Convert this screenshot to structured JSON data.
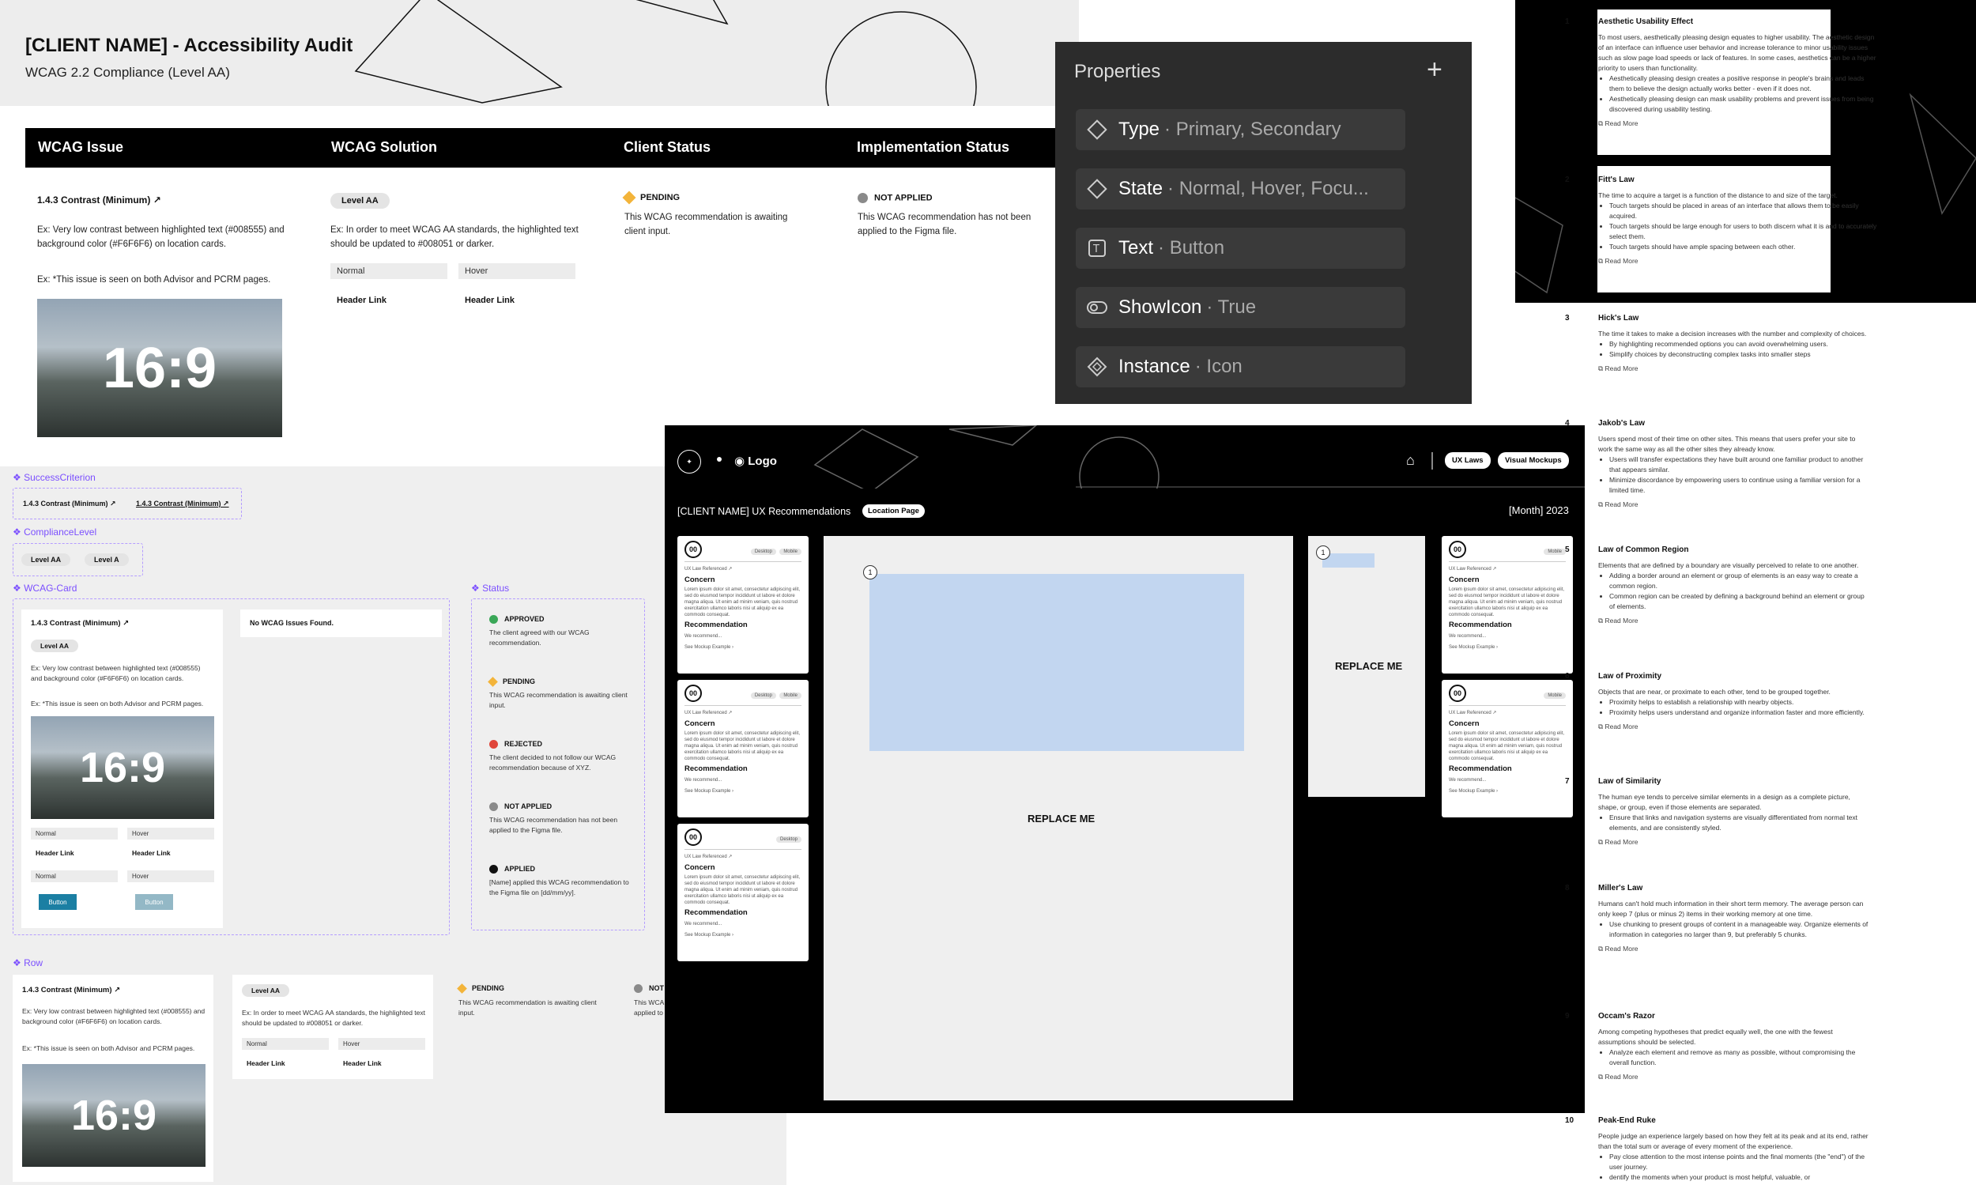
{
  "header": {
    "title": "[CLIENT NAME] - Accessibility Audit",
    "subtitle": "WCAG 2.2 Compliance (Level AA)"
  },
  "table": {
    "columns": [
      "WCAG Issue",
      "WCAG Solution",
      "Client Status",
      "Implementation Status"
    ],
    "issue": {
      "title": "1.4.3 Contrast (Minimum)",
      "desc": "Ex: Very low contrast between highlighted text (#008555) and background color (#F6F6F6) on location cards.",
      "note": "Ex: *This issue is seen on both Advisor and PCRM pages.",
      "image_label": "16:9"
    },
    "solution": {
      "level": "Level AA",
      "desc": "Ex: In order to meet WCAG AA standards, the highlighted text should be updated to #008051 or darker.",
      "field_normal": "Normal",
      "field_hover": "Hover",
      "link_normal": "Header Link",
      "link_hover": "Header Link"
    },
    "client_status": {
      "label": "PENDING",
      "desc": "This WCAG recommendation is awaiting client input."
    },
    "impl_status": {
      "label": "NOT APPLIED",
      "desc": "This WCAG recommendation has not been applied to the Figma file."
    }
  },
  "components": {
    "success_criterion": {
      "label": "SuccessCriterion",
      "items": [
        "1.4.3 Contrast (Minimum)",
        "1.4.3 Contrast (Minimum)"
      ]
    },
    "compliance_level": {
      "label": "ComplianceLevel",
      "items": [
        "Level AA",
        "Level A"
      ]
    },
    "wcag_card": {
      "label": "WCAG-Card",
      "title": "1.4.3 Contrast (Minimum)",
      "level": "Level AA",
      "desc": "Ex: Very low contrast between highlighted text (#008555) and background color (#F6F6F6) on location cards.",
      "note": "Ex: *This issue is seen on both Advisor and PCRM pages.",
      "image_label": "16:9",
      "field_normal": "Normal",
      "field_hover": "Hover",
      "link_normal": "Header Link",
      "link_hover": "Header Link",
      "field_normal2": "Normal",
      "field_hover2": "Hover",
      "button_normal": "Button",
      "button_hover": "Button",
      "empty": "No WCAG Issues Found."
    },
    "status": {
      "label": "Status",
      "items": [
        {
          "label": "APPROVED",
          "desc": "The client agreed with our WCAG recommendation.",
          "color": "#3aa757"
        },
        {
          "label": "PENDING",
          "desc": "This WCAG recommendation is awaiting client input.",
          "color": "#f3b43a"
        },
        {
          "label": "REJECTED",
          "desc": "The client decided to not follow our WCAG recommendation because of XYZ.",
          "color": "#e0453a"
        },
        {
          "label": "NOT APPLIED",
          "desc": "This WCAG recommendation has not been applied to the Figma file.",
          "color": "#8a8a8a"
        },
        {
          "label": "APPLIED",
          "desc": "[Name] applied this WCAG recommendation to the Figma file on [dd/mm/yy].",
          "color": "#111111"
        }
      ]
    },
    "row": {
      "label": "Row",
      "title": "1.4.3 Contrast (Minimum)",
      "desc": "Ex: Very low contrast between highlighted text (#008555) and background color (#F6F6F6) on location cards.",
      "note": "Ex: *This issue is seen on both Advisor and PCRM pages.",
      "image_label": "16:9",
      "level": "Level AA",
      "sol_desc": "Ex: In order to meet WCAG AA standards, the highlighted text should be updated to #008051 or darker.",
      "field_normal": "Normal",
      "field_hover": "Hover",
      "link_normal": "Header Link",
      "link_hover": "Header Link",
      "status_label": "PENDING",
      "status_desc": "This WCAG recommendation is awaiting client input.",
      "impl_label": "NOT",
      "impl_desc": "This WCA applied to"
    }
  },
  "properties": {
    "title": "Properties",
    "rows": [
      {
        "name": "Type",
        "value": "Primary, Secondary",
        "icon": "variant-diamond-icon"
      },
      {
        "name": "State",
        "value": "Normal, Hover, Focu...",
        "icon": "variant-diamond-icon"
      },
      {
        "name": "Text",
        "value": "Button",
        "icon": "text-icon"
      },
      {
        "name": "ShowIcon",
        "value": "True",
        "icon": "toggle-icon"
      },
      {
        "name": "Instance",
        "value": "Icon",
        "icon": "instance-icon"
      }
    ]
  },
  "ux": {
    "brand": "Logo",
    "nav_laws": "UX Laws",
    "nav_mockups": "Visual Mockups",
    "title": "[CLIENT NAME] UX Recommendations",
    "badge": "Location Page",
    "date": "[Month] 2023",
    "replace_main": "REPLACE ME",
    "replace_side": "REPLACE ME",
    "marker_main": "1",
    "marker_side": "1",
    "card_num": "00",
    "card_tag_desktop": "Desktop",
    "card_tag_mobile": "Mobile",
    "card_law_ref": "UX Law Referenced",
    "card_concern": "Concern",
    "card_lorem": "Lorem ipsum dolor sit amet, consectetur adipiscing elit, sed do eiusmod tempor incididunt ut labore et dolore magna aliqua. Ut enim ad minim veniam, quis nostrud exercitation ullamco laboris nisi ut aliquip ex ea commodo consequat.",
    "card_rec": "Recommendation",
    "card_we_rec": "We recommend...",
    "card_see": "See Mockup Example"
  },
  "laws": [
    {
      "n": "1",
      "title": "Aesthetic Usability Effect",
      "body": "To most users, aesthetically pleasing design equates to higher usability. The aesthetic design of an interface can influence user behavior and increase tolerance to minor usability issues such as slow page load speeds or lack of features. In some cases, aesthetics can be a higher priority to users than functionality.",
      "bullets": [
        "Aesthetically pleasing design creates a positive response in people's brains and leads them to believe the design actually works better - even if it does not.",
        "Aesthetically pleasing design can mask usability problems and prevent issues from being discovered during usability testing."
      ]
    },
    {
      "n": "2",
      "title": "Fitt's Law",
      "body": "The time to acquire a target is a function of the distance to and size of the target.",
      "bullets": [
        "Touch targets should be placed in areas of an interface that allows them to be easily acquired.",
        "Touch targets should be large enough for users to both discern what it is and to accurately select them.",
        "Touch targets should have ample spacing between each other."
      ]
    },
    {
      "n": "3",
      "title": "Hick's Law",
      "body": "The time it takes to make a decision increases with the number and complexity of choices.",
      "bullets": [
        "By highlighting recommended options you can avoid overwhelming users.",
        "Simplify choices by deconstructing complex tasks into smaller steps"
      ]
    },
    {
      "n": "4",
      "title": "Jakob's Law",
      "body": "Users spend most of their time on other sites. This means that users prefer your site to work the same way as all the other sites they already know.",
      "bullets": [
        "Users will transfer expectations they have built around one familiar product to another that appears similar.",
        "Minimize discordance by empowering users to continue using a familiar version for a limited time."
      ]
    },
    {
      "n": "5",
      "title": "Law of Common Region",
      "body": "Elements that are defined by a boundary are visually perceived to relate to one another.",
      "bullets": [
        "Adding a border around an element or group of elements is an easy way to create a common region.",
        "Common region can be created by defining a background behind an element or group of elements."
      ]
    },
    {
      "n": "6",
      "title": "Law of Proximity",
      "body": "Objects that are near, or proximate to each other, tend to be grouped together.",
      "bullets": [
        "Proximity helps to establish a relationship with nearby objects.",
        "Proximity helps users understand and organize information faster and more efficiently."
      ]
    },
    {
      "n": "7",
      "title": "Law of Similarity",
      "body": "The human eye tends to perceive similar elements in a design as a complete picture, shape, or group, even if those elements are separated.",
      "bullets": [
        "Ensure that links and navigation systems are visually differentiated from normal text elements, and are consistently styled."
      ]
    },
    {
      "n": "8",
      "title": "Miller's Law",
      "body": "Humans can't hold much information in their short term memory. The average person can only keep 7 (plus or minus 2) items in their working memory at one time.",
      "bullets": [
        "Use chunking to present groups of content in a manageable way. Organize elements of information in categories no larger than 9, but preferably 5 chunks."
      ]
    },
    {
      "n": "9",
      "title": "Occam's Razor",
      "body": "Among competing hypotheses that predict equally well, the one with the fewest assumptions should be selected.",
      "bullets": [
        "Analyze each element and remove as many as possible, without compromising the overall function."
      ]
    },
    {
      "n": "10",
      "title": "Peak-End Ruke",
      "body": "People judge an experience largely based on how they felt at its peak and at its end, rather than the total sum or average of every moment of the experience.",
      "bullets": [
        "Pay close attention to the most intense points and the final moments (the \"end\") of the user journey.",
        "dentify the moments when your product is most helpful, valuable, or"
      ]
    }
  ],
  "read_more": "Read More"
}
